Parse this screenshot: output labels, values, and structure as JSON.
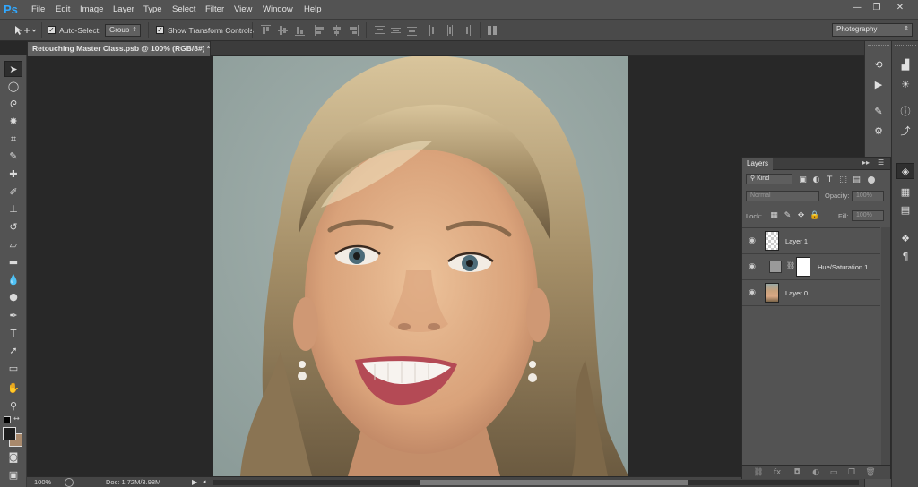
{
  "app": {
    "logo": "Ps"
  },
  "menu": [
    "File",
    "Edit",
    "Image",
    "Layer",
    "Type",
    "Select",
    "Filter",
    "View",
    "Window",
    "Help"
  ],
  "window_controls": {
    "minimize": "—",
    "restore": "❐",
    "close": "✕"
  },
  "options_bar": {
    "auto_select_label": "Auto-Select:",
    "auto_select_checked": true,
    "auto_select_mode": "Group",
    "transform_label": "Show Transform Controls",
    "transform_checked": true,
    "workspace": "Photography"
  },
  "document": {
    "tab_title": "Retouching Master Class.psb @ 100% (RGB/8#) *",
    "close_glyph": "×"
  },
  "status": {
    "zoom": "100%",
    "doc_info": "Doc: 1.72M/3.98M"
  },
  "tools": [
    "move-tool",
    "marquee-tool",
    "lasso-tool",
    "quick-select-tool",
    "crop-tool",
    "eyedropper-tool",
    "healing-brush-tool",
    "brush-tool",
    "clone-stamp-tool",
    "history-brush-tool",
    "eraser-tool",
    "gradient-tool",
    "blur-tool",
    "dodge-tool",
    "pen-tool",
    "type-tool",
    "path-select-tool",
    "shape-tool",
    "hand-tool",
    "zoom-tool"
  ],
  "layers_panel": {
    "tab": "Layers",
    "filter_kind": "Kind",
    "blend_mode": "Normal",
    "opacity_label": "Opacity:",
    "opacity_value": "100%",
    "lock_label": "Lock:",
    "fill_label": "Fill:",
    "fill_value": "100%",
    "layers": [
      {
        "name": "Layer 1",
        "type": "transparent"
      },
      {
        "name": "Hue/Saturation 1",
        "type": "adjustment"
      },
      {
        "name": "Layer 0",
        "type": "photo"
      }
    ]
  },
  "colors": {
    "ps_blue": "#31a8ff",
    "interface_bg": "#535353",
    "pasteboard": "#282828"
  }
}
